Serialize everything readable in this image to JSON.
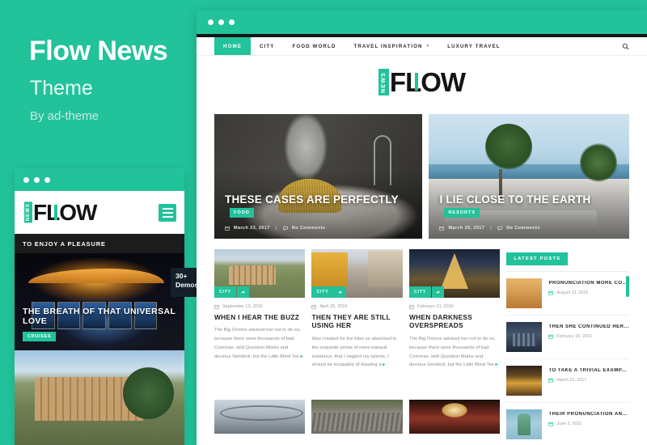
{
  "promo": {
    "title": "Flow News",
    "subtitle": "Theme",
    "author": "By ad-theme",
    "accent_color": "#22c29b",
    "demos_badge_line1": "30+",
    "demos_badge_line2": "Demos"
  },
  "site": {
    "logo_mark": "NEWS",
    "logo_text": "FLOW"
  },
  "nav": {
    "items": [
      {
        "label": "HOME",
        "active": true,
        "has_dropdown": false
      },
      {
        "label": "CITY",
        "active": false,
        "has_dropdown": false
      },
      {
        "label": "FOOD WORLD",
        "active": false,
        "has_dropdown": false
      },
      {
        "label": "TRAVEL INSPIRATION",
        "active": false,
        "has_dropdown": true
      },
      {
        "label": "LUXURY TRAVEL",
        "active": false,
        "has_dropdown": false
      }
    ],
    "search_icon": "search-icon",
    "caret": "▾"
  },
  "mobile": {
    "ticker": "TO ENJOY A PLEASURE",
    "menu_icon": "hamburger-icon",
    "hero": {
      "title": "THE BREATH OF THAT UNIVERSAL LOVE",
      "badge": "CRUISES"
    }
  },
  "hero_slider": [
    {
      "title": "THESE CASES ARE PERFECTLY",
      "badge": "FOOD",
      "date": "March 23, 2017",
      "comments": "No Comments",
      "image": "pasta-pot"
    },
    {
      "title": "I LIE CLOSE TO THE EARTH",
      "badge": "RESORTS",
      "date": "March 29, 2017",
      "comments": "No Comments",
      "image": "resort-terrace"
    }
  ],
  "cards": [
    {
      "tag": "CITY",
      "date": "September 13, 2016",
      "title": "WHEN I HEAR THE BUZZ",
      "excerpt": "The Big Oxmox advised her not to do so, because there were thousands of bad Commas, wild Question Marks and devious Semikoli, but the Little Blind Tex",
      "more": "▸",
      "image": "colosseum"
    },
    {
      "tag": "CITY",
      "date": "April 26, 2016",
      "title": "THEN THEY ARE STILL USING HER",
      "excerpt": "Was created for the bliss so absorbed in the exquisite sense of mere tranquil existence, that I neglect my talents. I should be incapable of drawing a",
      "more": "▸",
      "image": "street"
    },
    {
      "tag": "CITY",
      "date": "February 21, 2016",
      "title": "WHEN DARKNESS OVERSPREADS",
      "excerpt": "The Big Oxmox advised her not to do so, because there were thousands of bad Commas, wild Question Marks and devious Semikoli, but the Little Blind Tex",
      "more": "▸",
      "image": "eiffel"
    }
  ],
  "cards_row2": [
    {
      "image": "station"
    },
    {
      "image": "roof"
    },
    {
      "image": "train"
    }
  ],
  "sidebar": {
    "widget_title": "LATEST POSTS",
    "items": [
      {
        "title": "PRONUNCIATION MORE CO...",
        "date": "August 13, 2016",
        "image": "desert"
      },
      {
        "title": "THEN SHE CONTINUED HER...",
        "date": "February 18, 2016",
        "image": "london"
      },
      {
        "title": "TO TAKE A TRIVIAL EXAMP...",
        "date": "March 22, 2017",
        "image": "market"
      },
      {
        "title": "THEIR PRONUNCIATION AN...",
        "date": "June 2, 2016",
        "image": "liberty"
      }
    ]
  }
}
